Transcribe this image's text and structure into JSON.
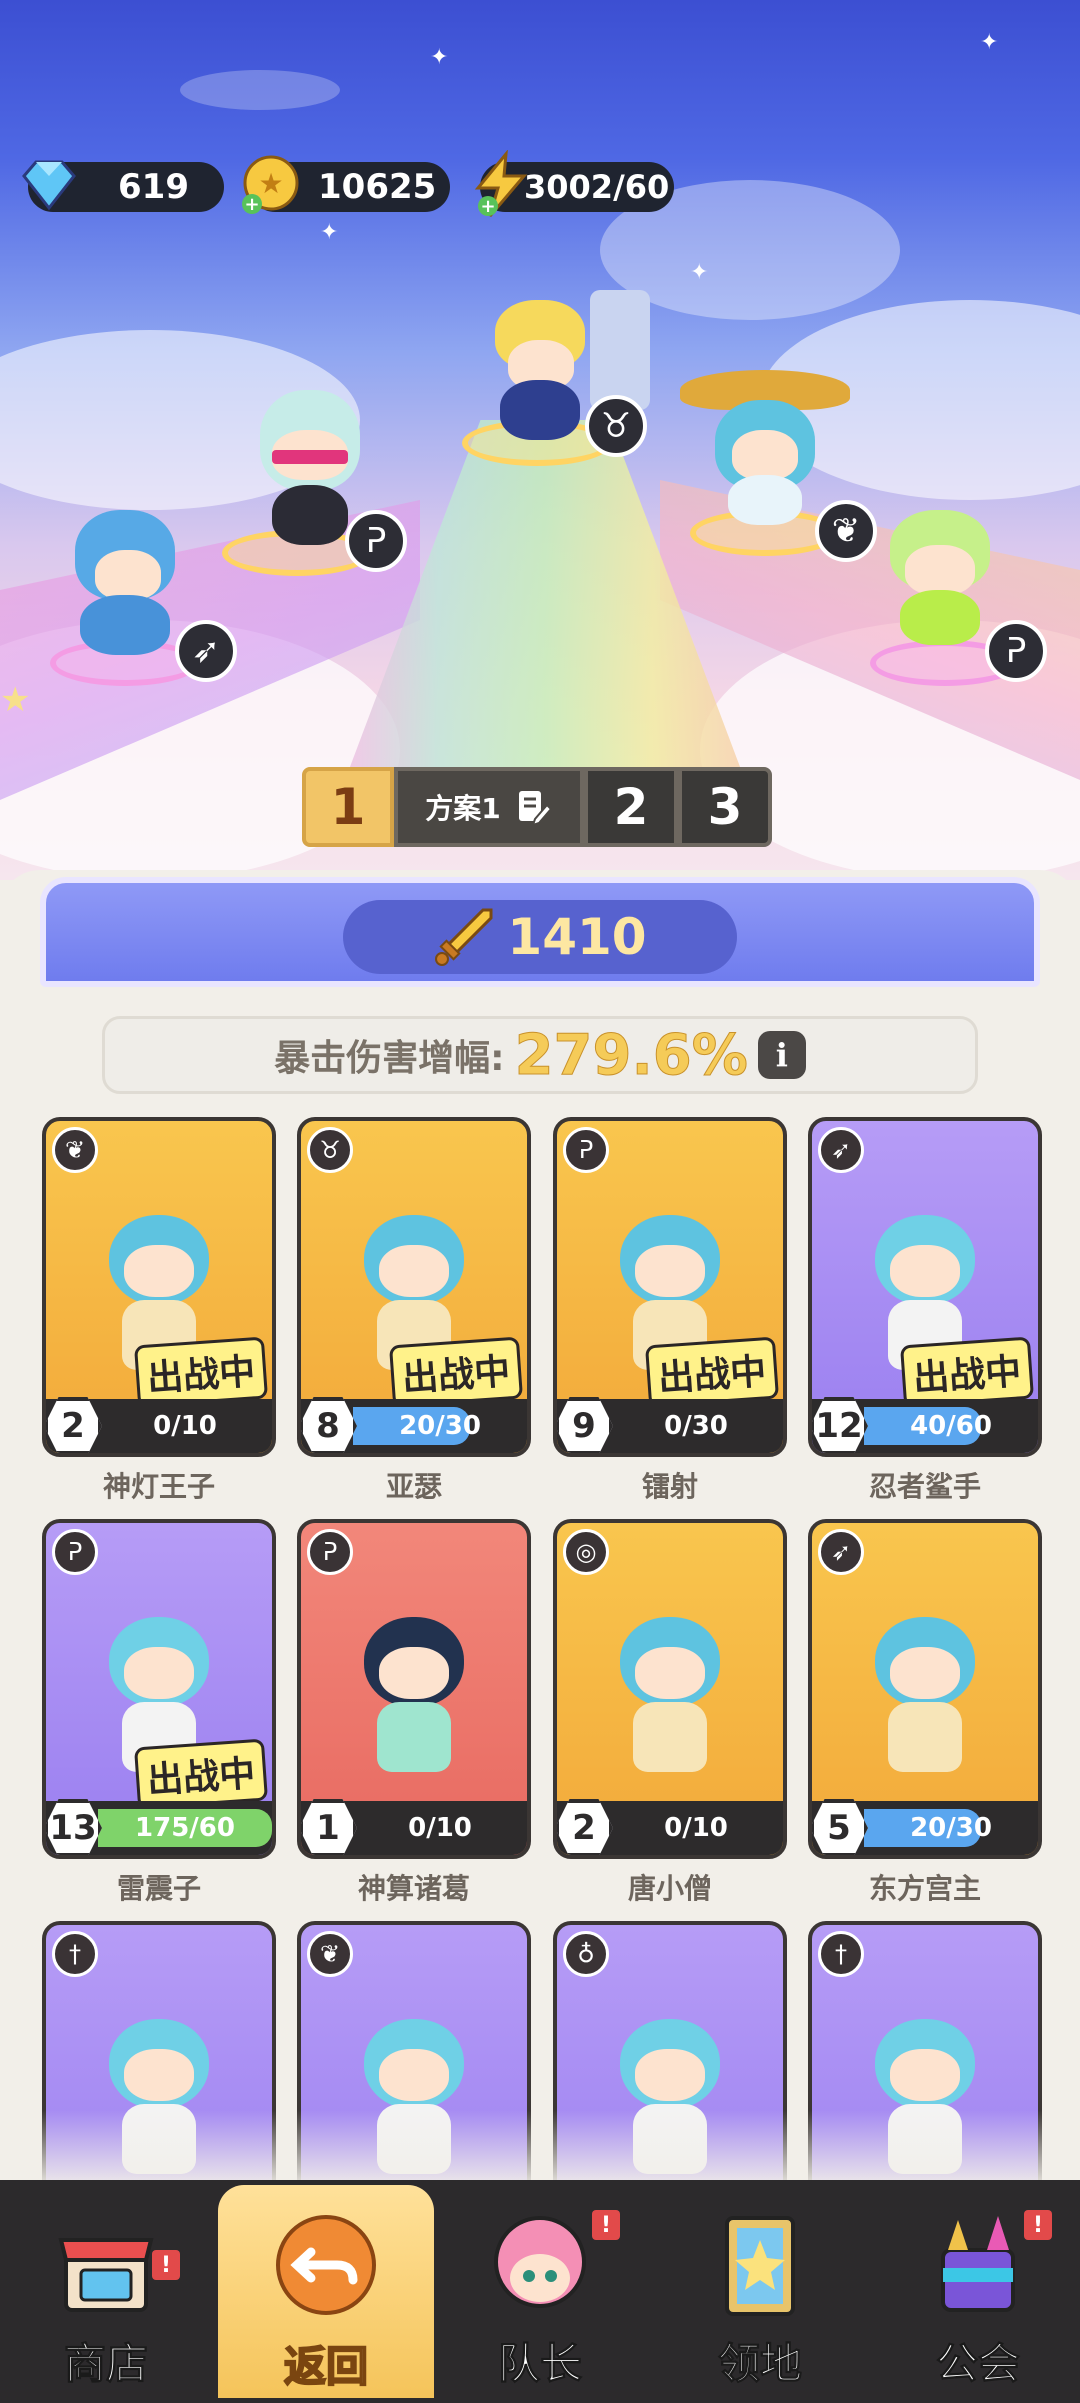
{
  "resources": {
    "gems": "619",
    "gold": "10625",
    "energy": "3002/60"
  },
  "plans": {
    "active_num": "1",
    "active_name": "方案1",
    "others": [
      "2",
      "3"
    ]
  },
  "power": {
    "value": "1410"
  },
  "crit": {
    "label": "暴击伤害增幅:",
    "value": "279.6%",
    "info": "i"
  },
  "deploy_tag": "出战中",
  "heroes": [
    {
      "name": "神灯王子",
      "level": "2",
      "progress": "0/10",
      "fraction": 0.0,
      "deployed": true,
      "class_icon": "wings-icon",
      "card_color": "yellow",
      "bar_color": "#5aa6ef"
    },
    {
      "name": "亚瑟",
      "level": "8",
      "progress": "20/30",
      "fraction": 0.67,
      "deployed": true,
      "class_icon": "bull-icon",
      "card_color": "yellow",
      "bar_color": "#5aa6ef"
    },
    {
      "name": "镭射",
      "level": "9",
      "progress": "0/30",
      "fraction": 0.0,
      "deployed": true,
      "class_icon": "magic-icon",
      "card_color": "yellow",
      "bar_color": "#5aa6ef"
    },
    {
      "name": "忍者鲨手",
      "level": "12",
      "progress": "40/60",
      "fraction": 0.67,
      "deployed": true,
      "class_icon": "bow-icon",
      "card_color": "purple",
      "bar_color": "#5aa6ef"
    },
    {
      "name": "雷震子",
      "level": "13",
      "progress": "175/60",
      "fraction": 1.0,
      "deployed": true,
      "class_icon": "magic-icon",
      "card_color": "purple",
      "bar_color": "#7fd36a"
    },
    {
      "name": "神算诸葛",
      "level": "1",
      "progress": "0/10",
      "fraction": 0.0,
      "deployed": false,
      "class_icon": "magic-icon",
      "card_color": "red",
      "bar_color": "#5aa6ef"
    },
    {
      "name": "唐小僧",
      "level": "2",
      "progress": "0/10",
      "fraction": 0.0,
      "deployed": false,
      "class_icon": "swirl-icon",
      "card_color": "yellow",
      "bar_color": "#5aa6ef"
    },
    {
      "name": "东方宫主",
      "level": "5",
      "progress": "20/30",
      "fraction": 0.67,
      "deployed": false,
      "class_icon": "bow-icon",
      "card_color": "yellow",
      "bar_color": "#5aa6ef"
    },
    {
      "name": "",
      "level": "",
      "progress": "",
      "fraction": 0.0,
      "deployed": false,
      "class_icon": "sword-icon",
      "card_color": "purple",
      "bar_color": "#5aa6ef"
    },
    {
      "name": "",
      "level": "",
      "progress": "",
      "fraction": 0.0,
      "deployed": false,
      "class_icon": "wings-icon",
      "card_color": "purple",
      "bar_color": "#5aa6ef"
    },
    {
      "name": "",
      "level": "",
      "progress": "",
      "fraction": 0.0,
      "deployed": false,
      "class_icon": "potion-icon",
      "card_color": "purple",
      "bar_color": "#5aa6ef"
    },
    {
      "name": "",
      "level": "",
      "progress": "",
      "fraction": 0.0,
      "deployed": false,
      "class_icon": "sword-icon",
      "card_color": "purple",
      "bar_color": "#5aa6ef"
    }
  ],
  "nav": {
    "shop": "商店",
    "back": "返回",
    "captain": "队长",
    "territory": "领地",
    "guild": "公会",
    "alert_mark": "!"
  }
}
